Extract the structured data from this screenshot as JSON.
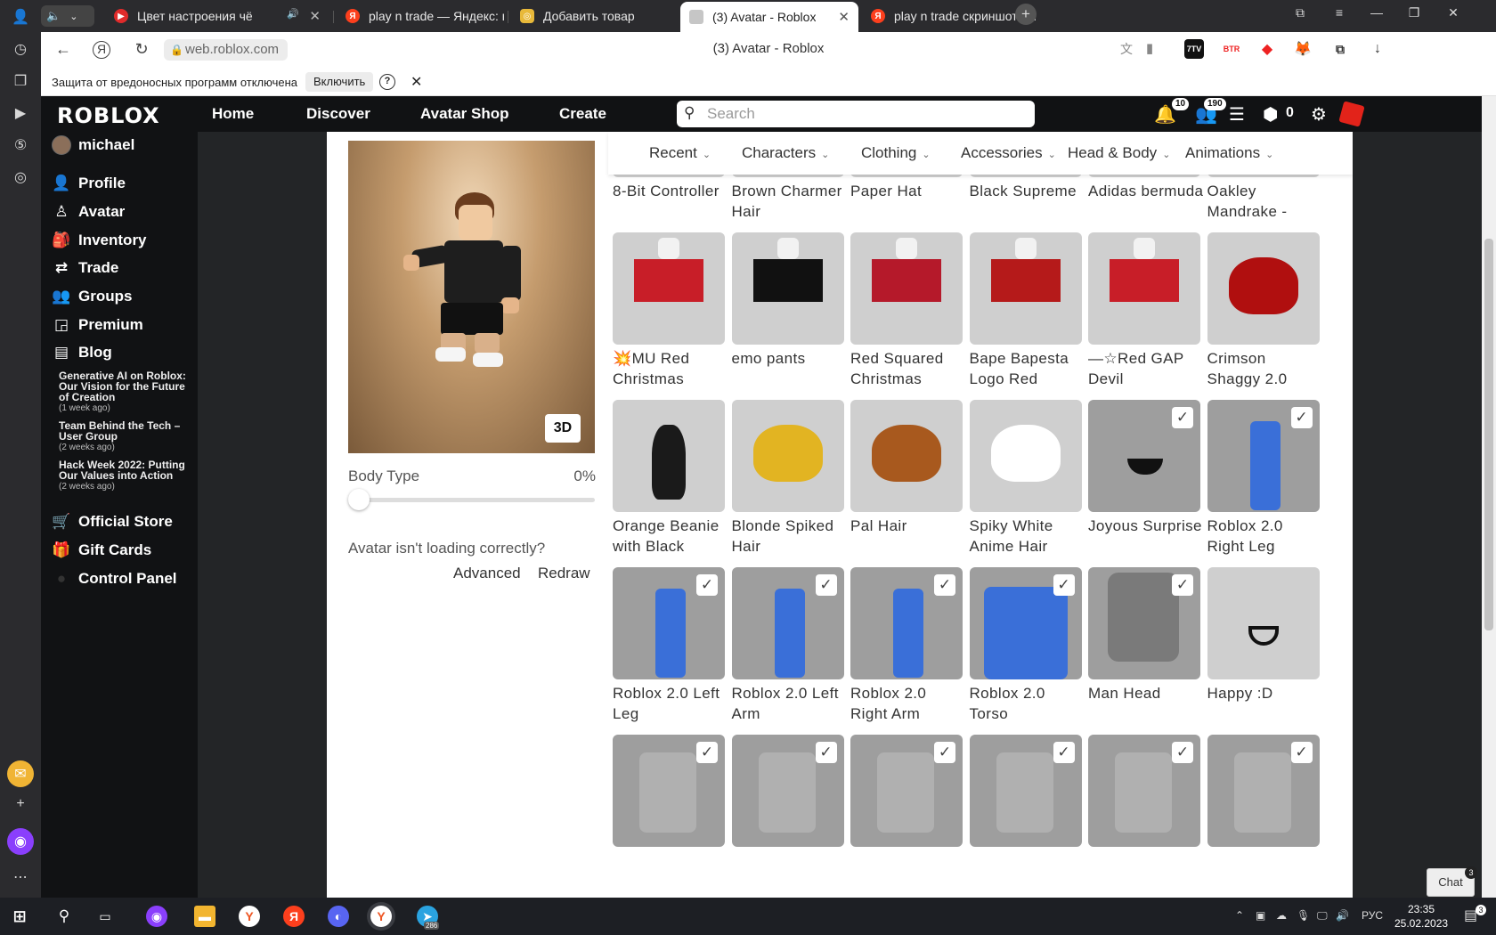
{
  "browser": {
    "tabs": [
      {
        "title": "Цвет настроения чё"
      },
      {
        "title": "play n trade — Яндекс: на"
      },
      {
        "title": "Добавить товар"
      },
      {
        "title": "(3) Avatar - Roblox"
      },
      {
        "title": "play n trade скриншоты ч"
      }
    ],
    "url": "web.roblox.com",
    "page_title": "(3) Avatar - Roblox",
    "protection_message": "Защита от вредоносных программ отключена",
    "protection_button": "Включить",
    "help_glyph": "?",
    "ext_labels": [
      "7TV",
      "BTR"
    ]
  },
  "header": {
    "logo": "ROBLOX",
    "nav": [
      "Home",
      "Discover",
      "Avatar Shop",
      "Create"
    ],
    "search_placeholder": "Search",
    "notifications_count": "10",
    "friends_count": "190",
    "robux": "0"
  },
  "sidebar": {
    "username": "michael",
    "items": [
      "Profile",
      "Avatar",
      "Inventory",
      "Trade",
      "Groups",
      "Premium",
      "Blog"
    ],
    "blog_posts": [
      {
        "title": "Generative AI on Roblox: Our Vision for the Future of Creation",
        "ago": "(1 week ago)"
      },
      {
        "title": "Team Behind the Tech – User Group",
        "ago": "(2 weeks ago)"
      },
      {
        "title": "Hack Week 2022: Putting Our Values into Action",
        "ago": "(2 weeks ago)"
      }
    ],
    "bottom_items": [
      "Official Store",
      "Gift Cards",
      "Control Panel"
    ]
  },
  "avatar": {
    "view_toggle": "3D",
    "body_type_label": "Body Type",
    "body_type_value": "0%",
    "body_type_level": 0,
    "loading_message": "Avatar isn't loading correctly?",
    "advanced_link": "Advanced",
    "redraw_link": "Redraw"
  },
  "categories": [
    "Recent",
    "Characters",
    "Clothing",
    "Accessories",
    "Head & Body",
    "Animations"
  ],
  "items": [
    {
      "name": "8-Bit Controller",
      "worn": false
    },
    {
      "name": "Brown Charmer Hair",
      "worn": false
    },
    {
      "name": "Paper Hat",
      "worn": false
    },
    {
      "name": "Black Supreme",
      "worn": false
    },
    {
      "name": "Adidas bermuda",
      "worn": false
    },
    {
      "name": "Oakley Mandrake -",
      "worn": false
    },
    {
      "name": "💥MU Red Christmas",
      "worn": false
    },
    {
      "name": "emo pants",
      "worn": false
    },
    {
      "name": "Red Squared Christmas",
      "worn": false
    },
    {
      "name": "Bape Bapesta Logo Red",
      "worn": false
    },
    {
      "name": "—☆Red GAP Devil",
      "worn": false
    },
    {
      "name": "Crimson Shaggy 2.0",
      "worn": false
    },
    {
      "name": "Orange Beanie with Black",
      "worn": false
    },
    {
      "name": "Blonde Spiked Hair",
      "worn": false
    },
    {
      "name": "Pal Hair",
      "worn": false
    },
    {
      "name": "Spiky White Anime Hair",
      "worn": false
    },
    {
      "name": "Joyous Surprise",
      "worn": true
    },
    {
      "name": "Roblox 2.0 Right Leg",
      "worn": true
    },
    {
      "name": "Roblox 2.0 Left Leg",
      "worn": true
    },
    {
      "name": "Roblox 2.0 Left Arm",
      "worn": true
    },
    {
      "name": "Roblox 2.0 Right Arm",
      "worn": true
    },
    {
      "name": "Roblox 2.0 Torso",
      "worn": true
    },
    {
      "name": "Man Head",
      "worn": true
    },
    {
      "name": "Happy :D",
      "worn": false
    },
    {
      "name": "",
      "worn": true
    },
    {
      "name": "",
      "worn": true
    },
    {
      "name": "",
      "worn": true
    },
    {
      "name": "",
      "worn": true
    },
    {
      "name": "",
      "worn": true
    },
    {
      "name": "",
      "worn": true
    }
  ],
  "chat": {
    "label": "Chat",
    "badge": "3"
  },
  "taskbar": {
    "lang": "РУС",
    "time": "23:35",
    "date": "25.02.2023",
    "telegram_badge": "286",
    "notification_badge": "3"
  },
  "colors": {
    "roblox_header": "#111214",
    "sidebar_bg": "#111214",
    "main_gutter": "#232527",
    "thumb_bg": "#cfcfcf",
    "thumb_worn_bg": "#9e9e9e"
  }
}
